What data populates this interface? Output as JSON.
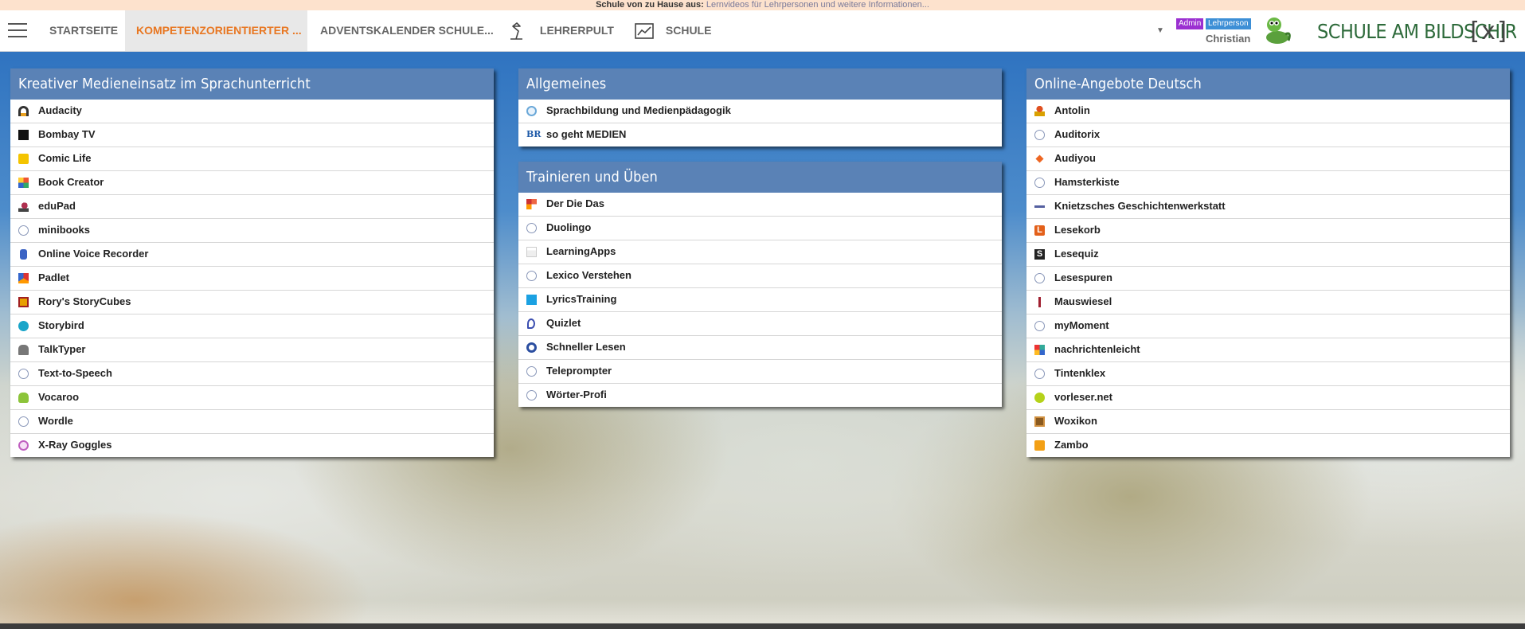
{
  "infobar": {
    "label": "Schule von zu Hause aus:",
    "link": "Lernvideos für Lehrpersonen und weitere Informationen..."
  },
  "nav": {
    "tabs": [
      {
        "label": "STARTSEITE",
        "active": false
      },
      {
        "label": "KOMPETENZORIENTIERTER ...",
        "active": true
      },
      {
        "label": "ADVENTSKALENDER SCHULE...",
        "active": false
      },
      {
        "label": "LEHRERPULT",
        "active": false,
        "icon": "desk-lamp-icon"
      },
      {
        "label": "SCHULE",
        "active": false,
        "icon": "chart-icon"
      }
    ],
    "active_color": "#e87722"
  },
  "user": {
    "badge_admin": "Admin",
    "badge_role": "Lehrperson",
    "name": "Christian"
  },
  "logo_text": "SCHULE AM BILDSCHIRM",
  "colors": {
    "card_header": "#5a82b6",
    "infobar": "#fde2cd",
    "badge_admin": "#9b30d1",
    "badge_role": "#3d8fd6"
  },
  "cards": {
    "medien": {
      "title": "Kreativer Medieneinsatz im Sprachunterricht",
      "items": [
        {
          "label": "Audacity",
          "icon": "headphones-icon"
        },
        {
          "label": "Bombay TV",
          "icon": "bombay-tv-icon"
        },
        {
          "label": "Comic Life",
          "icon": "comic-life-icon"
        },
        {
          "label": "Book Creator",
          "icon": "book-creator-icon"
        },
        {
          "label": "eduPad",
          "icon": "edupad-icon"
        },
        {
          "label": "minibooks",
          "icon": "globe-icon"
        },
        {
          "label": "Online Voice Recorder",
          "icon": "voice-recorder-icon"
        },
        {
          "label": "Padlet",
          "icon": "padlet-icon"
        },
        {
          "label": "Rory's StoryCubes",
          "icon": "story-cubes-icon"
        },
        {
          "label": "Storybird",
          "icon": "storybird-icon"
        },
        {
          "label": "TalkTyper",
          "icon": "talktyper-icon"
        },
        {
          "label": "Text-to-Speech",
          "icon": "globe-icon"
        },
        {
          "label": "Vocaroo",
          "icon": "vocaroo-icon"
        },
        {
          "label": "Wordle",
          "icon": "globe-icon"
        },
        {
          "label": "X-Ray Goggles",
          "icon": "xray-goggles-icon"
        }
      ]
    },
    "allgemeines": {
      "title": "Allgemeines",
      "items": [
        {
          "label": "Sprachbildung und Medienpädagogik",
          "icon": "sprachbildung-icon"
        },
        {
          "label": "so geht MEDIEN",
          "icon": "br-icon"
        }
      ]
    },
    "trainieren": {
      "title": "Trainieren und Üben",
      "items": [
        {
          "label": "Der Die Das",
          "icon": "der-die-das-icon"
        },
        {
          "label": "Duolingo",
          "icon": "globe-icon"
        },
        {
          "label": "LearningApps",
          "icon": "learningapps-icon"
        },
        {
          "label": "Lexico Verstehen",
          "icon": "globe-icon"
        },
        {
          "label": "LyricsTraining",
          "icon": "lyricstraining-icon"
        },
        {
          "label": "Quizlet",
          "icon": "quizlet-icon"
        },
        {
          "label": "Schneller Lesen",
          "icon": "schneller-lesen-icon"
        },
        {
          "label": "Teleprompter",
          "icon": "globe-icon"
        },
        {
          "label": "Wörter-Profi",
          "icon": "globe-icon"
        }
      ]
    },
    "deutsch": {
      "title": "Online-Angebote Deutsch",
      "items": [
        {
          "label": "Antolin",
          "icon": "antolin-icon"
        },
        {
          "label": "Auditorix",
          "icon": "globe-icon"
        },
        {
          "label": "Audiyou",
          "icon": "audiyou-icon"
        },
        {
          "label": "Hamsterkiste",
          "icon": "globe-icon"
        },
        {
          "label": "Knietzsches Geschichtenwerkstatt",
          "icon": "knietzsche-icon"
        },
        {
          "label": "Lesekorb",
          "icon": "lesekorb-icon"
        },
        {
          "label": "Lesequiz",
          "icon": "lesequiz-icon"
        },
        {
          "label": "Lesespuren",
          "icon": "globe-icon"
        },
        {
          "label": "Mauswiesel",
          "icon": "mauswiesel-icon"
        },
        {
          "label": "myMoment",
          "icon": "globe-icon"
        },
        {
          "label": "nachrichtenleicht",
          "icon": "nachrichtenleicht-icon"
        },
        {
          "label": "Tintenklex",
          "icon": "globe-icon"
        },
        {
          "label": "vorleser.net",
          "icon": "vorleser-icon"
        },
        {
          "label": "Woxikon",
          "icon": "woxikon-icon"
        },
        {
          "label": "Zambo",
          "icon": "zambo-icon"
        }
      ]
    }
  }
}
